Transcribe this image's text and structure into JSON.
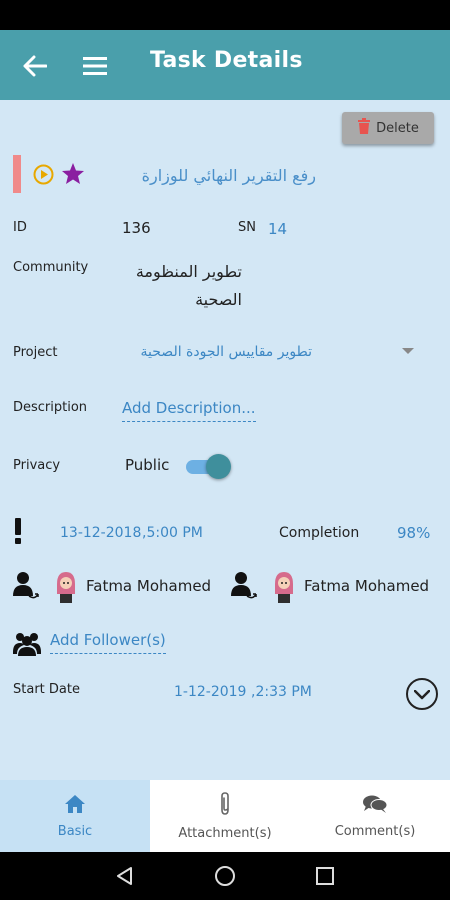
{
  "app_bar": {
    "title": "Task Details"
  },
  "toolbar": {
    "delete_label": "Delete"
  },
  "task": {
    "title": "رفع التقرير النهائي للوزارة",
    "id_label": "ID",
    "id_value": "136",
    "sn_label": "SN",
    "sn_value": "14",
    "community_label": "Community",
    "community_value": "تطوير المنظومة الصحية",
    "project_label": "Project",
    "project_value": "تطوير مقاييس الجودة الصحية",
    "description_label": "Description",
    "description_link": "Add Description...",
    "privacy_label": "Privacy",
    "privacy_value": "Public",
    "privacy_on": true,
    "due_date": "13-12-2018",
    "due_time": ",5:00 PM",
    "completion_label": "Completion",
    "completion_value": "98%",
    "people": [
      {
        "name": "Fatma Mohamed"
      },
      {
        "name": "Fatma Mohamed"
      }
    ],
    "add_follower": "Add Follower(s)",
    "start_label": "Start Date",
    "start_date": "1-12-2019",
    "start_time": ",2:33 PM"
  },
  "tabs": [
    {
      "label": "Basic",
      "icon": "home-icon",
      "active": true
    },
    {
      "label": "Attachment(s)",
      "icon": "paperclip-icon",
      "active": false
    },
    {
      "label": "Comment(s)",
      "icon": "comments-icon",
      "active": false
    }
  ],
  "colors": {
    "app_bar": "#4a9fab",
    "background": "#d3e7f5",
    "accent_blue": "#3c87c4",
    "active_tab": "#c6e1f4",
    "star": "#8a1fa0",
    "play": "#e8a800"
  }
}
